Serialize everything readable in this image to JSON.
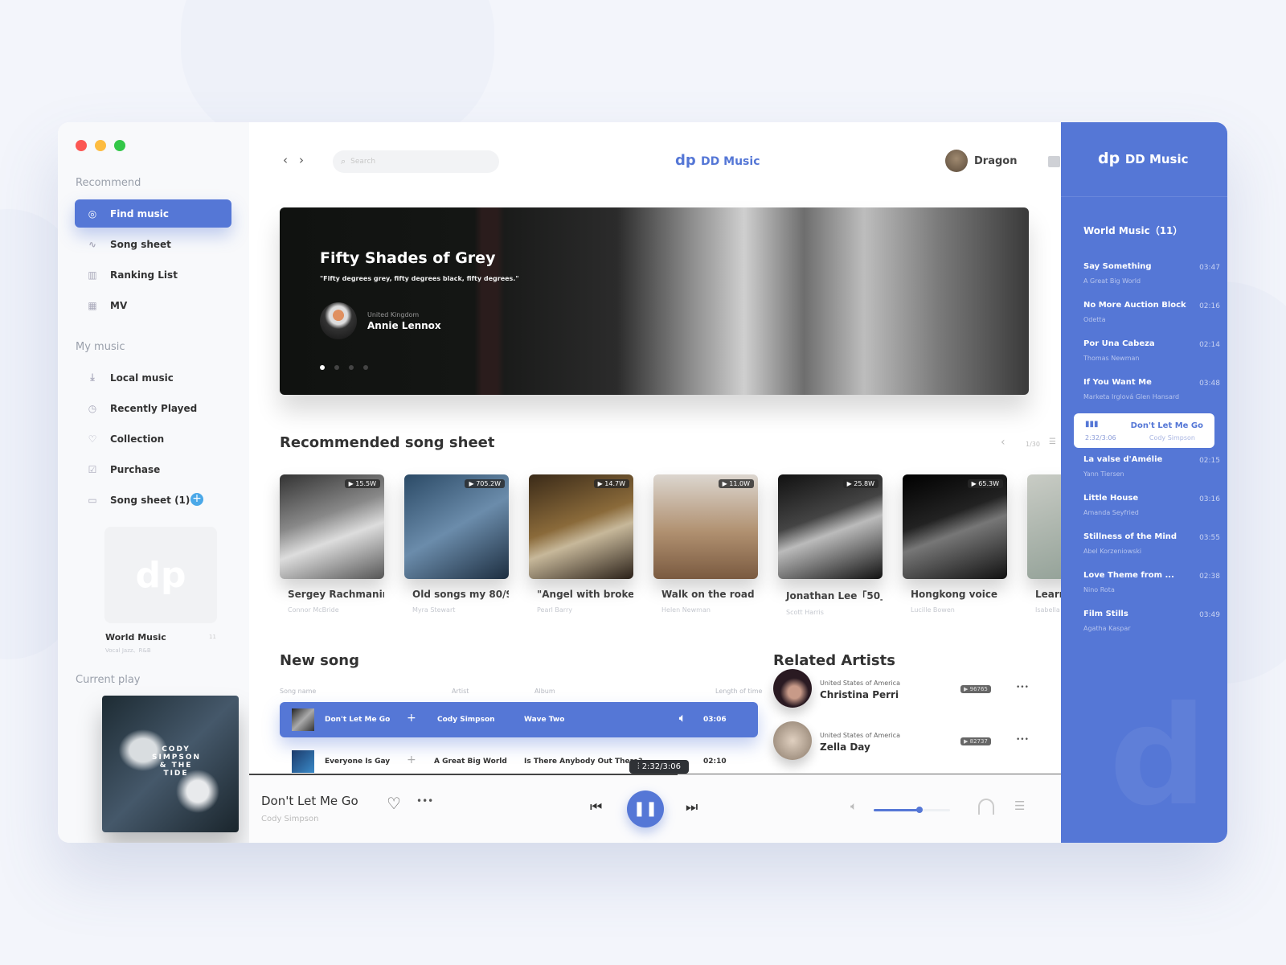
{
  "colors": {
    "accent": "#5577d6",
    "background": "#f3f5fb"
  },
  "sidebar": {
    "section_recommend": "Recommend",
    "recommend_items": [
      {
        "label": "Find music",
        "icon": "compass-icon",
        "active": true
      },
      {
        "label": "Song sheet",
        "icon": "pulse-icon"
      },
      {
        "label": "Ranking List",
        "icon": "bar-chart-icon"
      },
      {
        "label": "MV",
        "icon": "film-icon"
      }
    ],
    "section_my_music": "My music",
    "my_items": [
      {
        "label": "Local music",
        "icon": "download-icon"
      },
      {
        "label": "Recently Played",
        "icon": "clock-icon"
      },
      {
        "label": "Collection",
        "icon": "heart-icon"
      },
      {
        "label": "Purchase",
        "icon": "checkbox-icon"
      },
      {
        "label": "Song sheet (1)",
        "icon": "folder-icon"
      }
    ],
    "playlist": {
      "title": "World Music",
      "subtitle": "Vocal Jazz、R&B",
      "count": "11"
    },
    "current_play_label": "Current play",
    "cover_text": "CODY SIMPSON & THE TIDE"
  },
  "header": {
    "search_placeholder": "Search",
    "logo": "DD Music",
    "user": "Dragon"
  },
  "banner": {
    "title": "Fifty Shades of Grey",
    "quote": "\"Fifty degrees grey, fifty degrees black, fifty degrees.\"",
    "artist_country": "United Kingdom",
    "artist": "Annie Lennox",
    "slides": 4,
    "active_slide": 1
  },
  "recommended": {
    "title": "Recommended song sheet",
    "pager": "1/30",
    "cards": [
      {
        "title": "Sergey Rachmanin...",
        "sub": "Connor McBride",
        "plays": "15.5W"
      },
      {
        "title": "Old songs my 80/90.",
        "sub": "Myra Stewart",
        "plays": "705.2W"
      },
      {
        "title": "\"Angel with broken...",
        "sub": "Pearl Barry",
        "plays": "14.7W"
      },
      {
        "title": "Walk on the road",
        "sub": "Helen Newman",
        "plays": "11.0W"
      },
      {
        "title": "Jonathan Lee「50」",
        "sub": "Scott Harris",
        "plays": "25.8W"
      },
      {
        "title": "Hongkong voice",
        "sub": "Lucille Bowen",
        "plays": "65.3W"
      },
      {
        "title": "Learni",
        "sub": "Isabella",
        "plays": ""
      }
    ]
  },
  "new_song": {
    "title": "New song",
    "headers": [
      "Song name",
      "Artist",
      "Album",
      "Length of time"
    ],
    "rows": [
      {
        "name": "Don't Let Me Go",
        "artist": "Cody Simpson",
        "album": "Wave Two",
        "length": "03:06",
        "active": true
      },
      {
        "name": "Everyone Is Gay",
        "artist": "A Great Big World",
        "album": "Is There Anybody Out There?",
        "length": "02:10"
      }
    ]
  },
  "related": {
    "title": "Related Artists",
    "artists": [
      {
        "country": "United States of America",
        "name": "Christina Perri",
        "plays": "96765"
      },
      {
        "country": "United States of America",
        "name": "Zella Day",
        "plays": "82737"
      }
    ]
  },
  "player": {
    "title": "Don't Let Me Go",
    "artist": "Cody Simpson",
    "time": "2:32/3:06",
    "progress": 0.82,
    "volume": 0.6
  },
  "right_panel": {
    "logo": "DD Music",
    "playlist_title": "World Music（11）",
    "songs": [
      {
        "title": "Say Something",
        "artist": "A Great Big World",
        "duration": "03:47"
      },
      {
        "title": "No More Auction Block",
        "artist": "Odetta",
        "duration": "02:16"
      },
      {
        "title": "Por Una Cabeza",
        "artist": "Thomas Newman",
        "duration": "02:14"
      },
      {
        "title": "If You Want Me",
        "artist": "Marketa Irglová Glen Hansard",
        "duration": "03:48"
      },
      {
        "title": "Don't Let Me Go",
        "artist": "Cody Simpson",
        "duration": "2:32/3:06",
        "playing": true
      },
      {
        "title": "La valse d'Amélie",
        "artist": "Yann Tiersen",
        "duration": "02:15"
      },
      {
        "title": "Little House",
        "artist": "Amanda Seyfried",
        "duration": "03:16"
      },
      {
        "title": "Stillness of the Mind",
        "artist": "Abel Korzeniowski",
        "duration": "03:55"
      },
      {
        "title": "Love Theme from ...",
        "artist": "Nino Rota",
        "duration": "02:38"
      },
      {
        "title": "Film Stills",
        "artist": "Agatha Kaspar",
        "duration": "03:49"
      }
    ]
  }
}
